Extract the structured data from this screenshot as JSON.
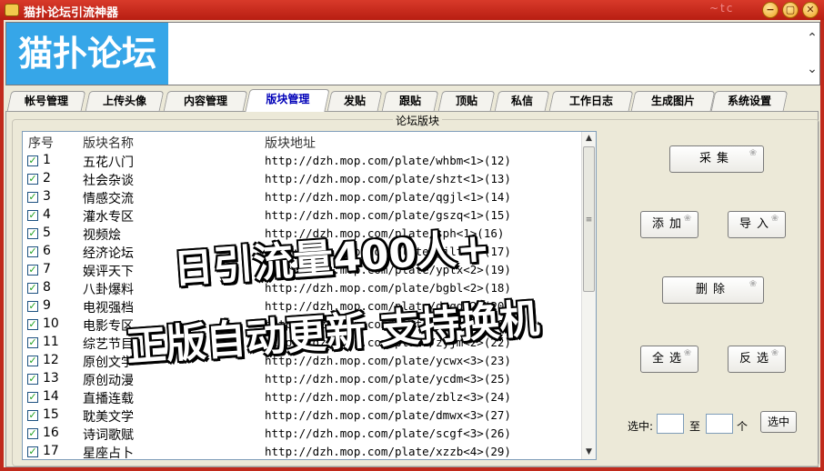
{
  "window": {
    "title": "猫扑论坛引流神器",
    "title_decoration": "~tc"
  },
  "window_buttons": {
    "minimize": "−",
    "maximize": "▢",
    "close": "✕"
  },
  "banner": {
    "logo_text": "猫扑论坛",
    "scroll_up": "⌃",
    "scroll_down": "⌄"
  },
  "tabs": [
    "帐号管理",
    "上传头像",
    "内容管理",
    "版块管理",
    "发贴",
    "跟贴",
    "顶贴",
    "私信",
    "工作日志",
    "生成图片",
    "系统设置"
  ],
  "active_tab": "版块管理",
  "group": {
    "title": "论坛版块"
  },
  "list": {
    "headers": {
      "no": "序号",
      "name": "版块名称",
      "url": "版块地址"
    },
    "rows": [
      {
        "no": "1",
        "name": "五花八门",
        "url": "http://dzh.mop.com/plate/whbm<1>(12)"
      },
      {
        "no": "2",
        "name": "社会杂谈",
        "url": "http://dzh.mop.com/plate/shzt<1>(13)"
      },
      {
        "no": "3",
        "name": "情感交流",
        "url": "http://dzh.mop.com/plate/qgjl<1>(14)"
      },
      {
        "no": "4",
        "name": "灌水专区",
        "url": "http://dzh.mop.com/plate/gszq<1>(15)"
      },
      {
        "no": "5",
        "name": "视频烩",
        "url": "http://dzh.mop.com/plate/sph<1>(16)"
      },
      {
        "no": "6",
        "name": "经济论坛",
        "url": "http://dzh.mop.com/plate/jjlt<1>(17)"
      },
      {
        "no": "7",
        "name": "娱评天下",
        "url": "http://dzh.mop.com/plate/yptx<2>(19)"
      },
      {
        "no": "8",
        "name": "八卦爆料",
        "url": "http://dzh.mop.com/plate/bgbl<2>(18)"
      },
      {
        "no": "9",
        "name": "电视强档",
        "url": "http://dzh.mop.com/plate/dsqd<2>(20)"
      },
      {
        "no": "10",
        "name": "电影专区",
        "url": "http://dzh.mop.com/plate/dyzq<2>(21)"
      },
      {
        "no": "11",
        "name": "综艺节目",
        "url": "http://dzh.mop.com/plate/zyjm<2>(22)"
      },
      {
        "no": "12",
        "name": "原创文学",
        "url": "http://dzh.mop.com/plate/ycwx<3>(23)"
      },
      {
        "no": "13",
        "name": "原创动漫",
        "url": "http://dzh.mop.com/plate/ycdm<3>(25)"
      },
      {
        "no": "14",
        "name": "直播连载",
        "url": "http://dzh.mop.com/plate/zblz<3>(24)"
      },
      {
        "no": "15",
        "name": "耽美文学",
        "url": "http://dzh.mop.com/plate/dmwx<3>(27)"
      },
      {
        "no": "16",
        "name": "诗词歌赋",
        "url": "http://dzh.mop.com/plate/scgf<3>(26)"
      },
      {
        "no": "17",
        "name": "星座占卜",
        "url": "http://dzh.mop.com/plate/xzzb<4>(29)"
      }
    ]
  },
  "buttons": {
    "collect": "采集",
    "add": "添加",
    "import": "导入",
    "delete": "删除",
    "select_all": "全选",
    "invert": "反选",
    "select": "选中"
  },
  "range": {
    "label_select": "选中:",
    "label_to": "至",
    "label_unit": "个",
    "from_value": "",
    "to_value": ""
  },
  "promo": {
    "line1": "日引流量400人+",
    "line2": "正版自动更新 支持换机"
  }
}
